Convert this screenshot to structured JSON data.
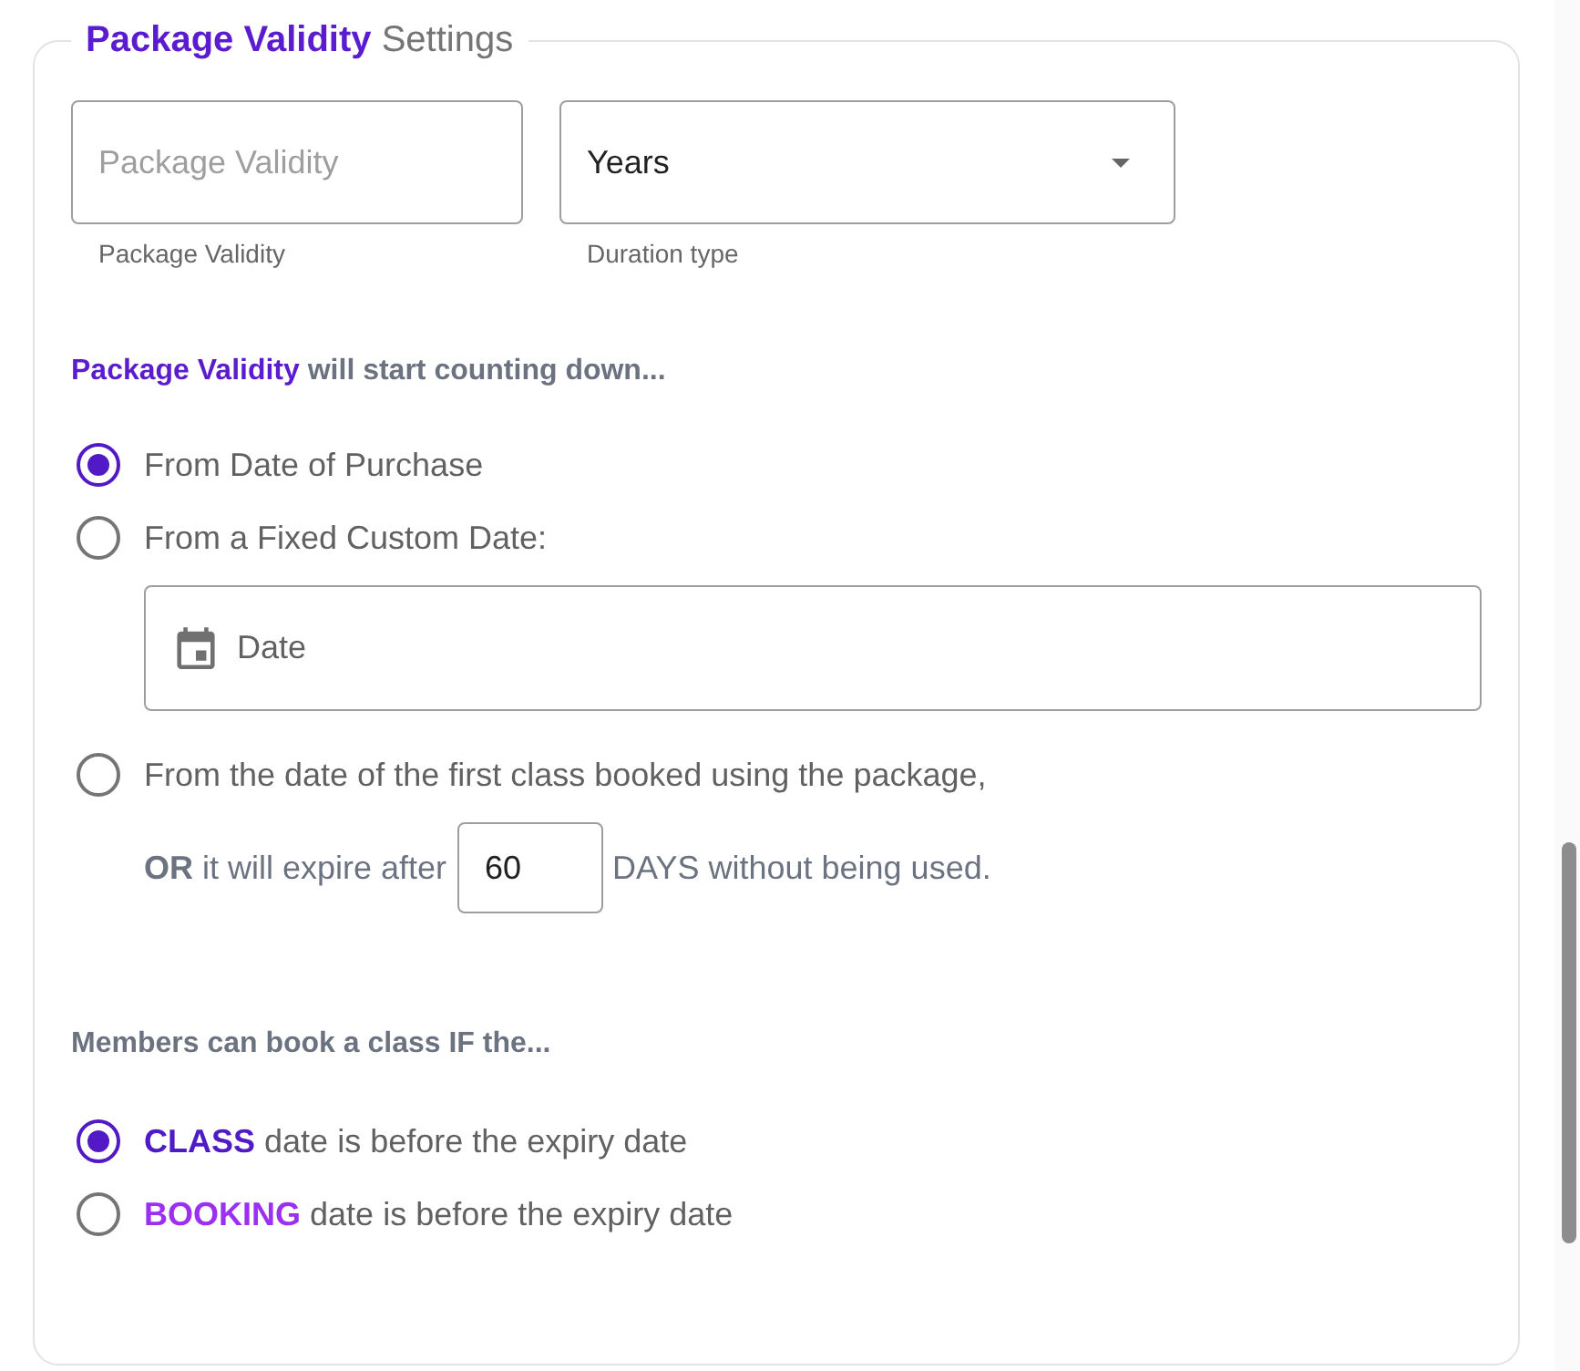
{
  "panel": {
    "legend": {
      "highlight": "Package Validity",
      "text": "Settings"
    }
  },
  "fields": [
    {
      "kind": "text",
      "placeholder": "Package Validity",
      "helper": "Package Validity"
    },
    {
      "kind": "select",
      "value": "Years",
      "helper": "Duration type"
    }
  ],
  "countdown": {
    "heading": {
      "highlight": "Package Validity",
      "text": "will start counting down..."
    },
    "options": [
      {
        "kind": "plain",
        "label": "From Date of Purchase",
        "selected": true
      },
      {
        "kind": "date",
        "label": "From a Fixed Custom Date:",
        "selected": false,
        "date_field": {
          "placeholder": "Date"
        }
      },
      {
        "kind": "expiry",
        "label": "From the date of the first class booked using the package,",
        "selected": false,
        "expiry": {
          "prefix": "**OR** it will expire after",
          "value": "60",
          "suffix": "DAYS without being used."
        }
      }
    ]
  },
  "booking_rule": {
    "heading": "Members can book a class IF the...",
    "options": [
      {
        "highlight": "CLASS",
        "text": "date is before the expiry date",
        "color": "#4f1bc4",
        "selected": true
      },
      {
        "highlight": "BOOKING",
        "text": "date is before the expiry date",
        "color": "#9b30f0",
        "selected": false
      }
    ]
  }
}
